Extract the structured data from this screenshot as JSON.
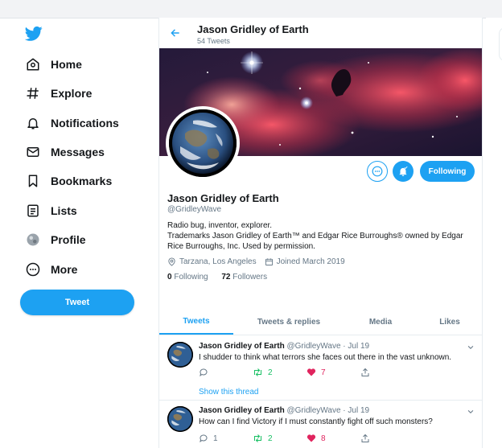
{
  "nav": {
    "items": [
      {
        "label": "Home",
        "icon": "home-icon"
      },
      {
        "label": "Explore",
        "icon": "hashtag-icon"
      },
      {
        "label": "Notifications",
        "icon": "bell-icon"
      },
      {
        "label": "Messages",
        "icon": "envelope-icon"
      },
      {
        "label": "Bookmarks",
        "icon": "bookmark-icon"
      },
      {
        "label": "Lists",
        "icon": "list-icon"
      },
      {
        "label": "Profile",
        "icon": "avatar-icon"
      },
      {
        "label": "More",
        "icon": "more-circle-icon"
      }
    ],
    "tweet_button": "Tweet"
  },
  "header": {
    "name": "Jason Gridley of Earth",
    "tweet_count": "54 Tweets"
  },
  "profile": {
    "name": "Jason Gridley of Earth",
    "handle": "@GridleyWave",
    "bio": "Radio bug, inventor, explorer.\nTrademarks Jason Gridley of Earth™ and Edgar Rice Burroughs® owned by Edgar Rice Burroughs, Inc. Used by permission.",
    "location": "Tarzana, Los Angeles",
    "joined": "Joined March 2019",
    "following_count": "0",
    "following_label": "Following",
    "followers_count": "72",
    "followers_label": "Followers",
    "following_button": "Following"
  },
  "tabs": [
    "Tweets",
    "Tweets & replies",
    "Media",
    "Likes"
  ],
  "tweets": [
    {
      "name": "Jason Gridley of Earth",
      "handle": "@GridleyWave",
      "date": "· Jul 19",
      "text": "I shudder to think what terrors she faces out there in the vast unknown.",
      "retweets": "2",
      "likes": "7",
      "replies": "",
      "show_thread": "Show this thread"
    },
    {
      "name": "Jason Gridley of Earth",
      "handle": "@GridleyWave",
      "date": "· Jul 19",
      "text": "How can I find Victory if I must constantly fight off such monsters?",
      "retweets": "2",
      "likes": "8",
      "replies": "1"
    }
  ],
  "colors": {
    "accent": "#1da1f2",
    "retweet": "#17bf63",
    "like": "#e0245e",
    "muted": "#657786"
  }
}
